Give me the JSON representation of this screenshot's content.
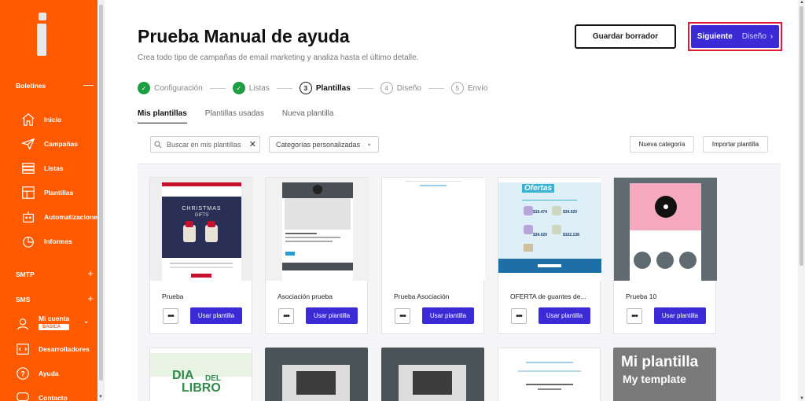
{
  "sidebar": {
    "section_boletines": "Boletines",
    "items": [
      {
        "label": "Inicio",
        "icon": "home-icon"
      },
      {
        "label": "Campañas",
        "icon": "send-icon"
      },
      {
        "label": "Listas",
        "icon": "list-icon"
      },
      {
        "label": "Plantillas",
        "icon": "template-icon"
      },
      {
        "label": "Automatizaciones",
        "icon": "automation-icon"
      },
      {
        "label": "Informes",
        "icon": "reports-icon"
      }
    ],
    "section_smtp": "SMTP",
    "section_sms": "SMS",
    "account_label": "Mi cuenta",
    "account_plan": "BÁSICA",
    "developers_label": "Desarrolladores",
    "help_label": "Ayuda",
    "contact_label": "Contacto",
    "minus": "—",
    "plus": "+"
  },
  "header": {
    "title": "Prueba Manual de ayuda",
    "subtitle": "Crea todo tipo de campañas de email marketing y analiza hasta el último detalle.",
    "draft_button": "Guardar borrador",
    "next_button_bold": "Siguiente",
    "next_button_step": "Diseño"
  },
  "stepper": [
    {
      "label": "Configuración",
      "state": "done",
      "num": "✓"
    },
    {
      "label": "Listas",
      "state": "done",
      "num": "✓"
    },
    {
      "label": "Plantillas",
      "state": "current",
      "num": "3"
    },
    {
      "label": "Diseño",
      "state": "todo",
      "num": "4"
    },
    {
      "label": "Envío",
      "state": "todo",
      "num": "5"
    }
  ],
  "tabs": [
    "Mis plantillas",
    "Plantillas usadas",
    "Nueva plantilla"
  ],
  "toolbar": {
    "search_placeholder": "Buscar en mis plantillas",
    "category_select": "Categorías personalizadas",
    "new_category": "Nueva categoría",
    "import_template": "Importar plantilla"
  },
  "templates": [
    {
      "name": "Prueba",
      "use": "Usar plantilla",
      "more": "•••"
    },
    {
      "name": "Asociación prueba",
      "use": "Usar plantilla",
      "more": "•••"
    },
    {
      "name": "Prueba Asociación",
      "use": "Usar plantilla",
      "more": "•••"
    },
    {
      "name": "OFERTA de guantes de...",
      "use": "Usar plantilla",
      "more": "•••"
    },
    {
      "name": "Prueba 10",
      "use": "Usar plantilla",
      "more": "•••"
    }
  ],
  "thumb_text": {
    "christmas": "CHRISTMAS",
    "gifts": "GIFTS",
    "ofertas": "Ofertas",
    "prices": [
      "$19.474",
      "$34.020",
      "$34.020",
      "$102.138"
    ],
    "dia": "DIA",
    "del": "DEL",
    "libro": "LIBRO",
    "mi_plantilla": "Mi plantilla",
    "my_template": "My template"
  },
  "colors": {
    "sidebar": "#ff5a00",
    "primary": "#3b2bd6",
    "success": "#1e9e43",
    "highlight": "#e01b36"
  }
}
